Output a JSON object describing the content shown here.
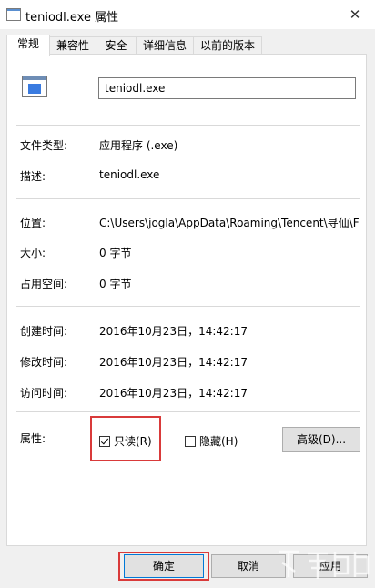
{
  "window": {
    "title": "teniodl.exe 属性",
    "close_label": "✕"
  },
  "tabs": [
    "常规",
    "兼容性",
    "安全",
    "详细信息",
    "以前的版本"
  ],
  "active_tab": "常规",
  "file": {
    "name": "teniodl.exe"
  },
  "details": {
    "type": {
      "label": "文件类型:",
      "value": "应用程序 (.exe)"
    },
    "description": {
      "label": "描述:",
      "value": "teniodl.exe"
    },
    "location": {
      "label": "位置:",
      "value": "C:\\Users\\jogla\\AppData\\Roaming\\Tencent\\寻仙\\F"
    },
    "size": {
      "label": "大小:",
      "value": "0 字节"
    },
    "size_on_disk": {
      "label": "占用空间:",
      "value": "0 字节"
    },
    "created": {
      "label": "创建时间:",
      "value": "2016年10月23日，14:42:17"
    },
    "modified": {
      "label": "修改时间:",
      "value": "2016年10月23日，14:42:17"
    },
    "accessed": {
      "label": "访问时间:",
      "value": "2016年10月23日，14:42:17"
    }
  },
  "attributes": {
    "label": "属性:",
    "readonly": {
      "label": "只读(R)",
      "checked": true
    },
    "hidden": {
      "label": "隐藏(H)",
      "checked": false
    },
    "advanced_button": "高级(D)..."
  },
  "buttons": {
    "ok": "确定",
    "cancel": "取消",
    "apply": "应用"
  },
  "colors": {
    "highlight": "#d93a3a",
    "accent": "#0078d7"
  }
}
